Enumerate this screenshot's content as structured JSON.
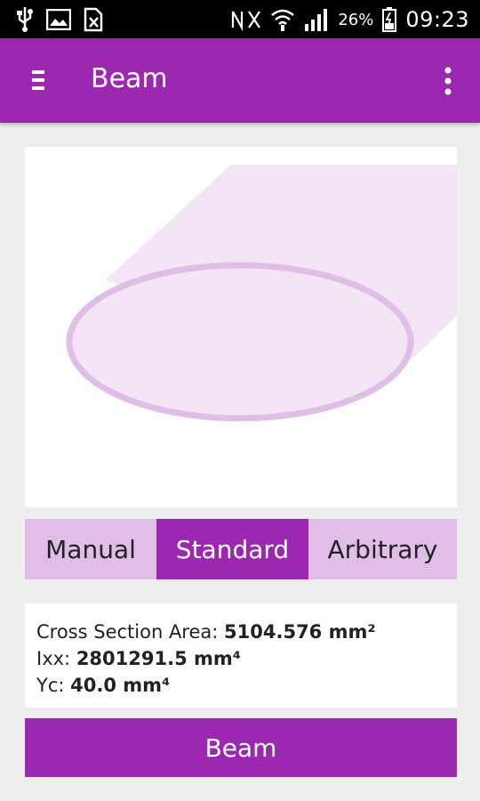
{
  "status_bar": {
    "icons_left": [
      "usb-icon",
      "image-icon",
      "sim-icon"
    ],
    "icons_right": [
      "mute-icon",
      "wifi-icon",
      "signal-icon"
    ],
    "battery_percent": "26%",
    "time": "09:23"
  },
  "app_bar": {
    "title": "Beam",
    "menu_icon": "hamburger-icon",
    "overflow_icon": "more-vert-icon",
    "color": "#9c27b0"
  },
  "section_view": {
    "shape": "elliptical-cylinder",
    "fill_color": "#f3e5f5",
    "stroke_color": "#e1bee7"
  },
  "tabs": [
    {
      "label": "Manual",
      "active": false
    },
    {
      "label": "Standard",
      "active": true
    },
    {
      "label": "Arbitrary",
      "active": false
    }
  ],
  "properties": {
    "area_label": "Cross Section Area:",
    "area_value": "5104.576 mm²",
    "ixx_label": "Ixx:",
    "ixx_value": "2801291.5 mm⁴",
    "yc_label": "Yc:",
    "yc_value": "40.0 mm⁴"
  },
  "action_button": {
    "label": "Beam"
  },
  "colors": {
    "primary": "#9c27b0",
    "tab_inactive": "#e1bee7",
    "background": "#eeeeee"
  }
}
